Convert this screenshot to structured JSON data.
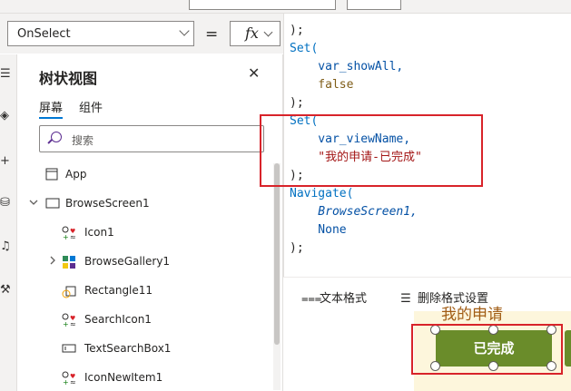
{
  "formula": {
    "property": "OnSelect",
    "equals": "=",
    "fx_label": "fx"
  },
  "tree": {
    "title": "树状视图",
    "close": "✕",
    "tabs": [
      "屏幕",
      "组件"
    ],
    "search_placeholder": "搜索",
    "items": [
      {
        "label": "App"
      },
      {
        "label": "BrowseScreen1"
      },
      {
        "label": "Icon1"
      },
      {
        "label": "BrowseGallery1"
      },
      {
        "label": "Rectangle11"
      },
      {
        "label": "SearchIcon1"
      },
      {
        "label": "TextSearchBox1"
      },
      {
        "label": "IconNewItem1"
      }
    ]
  },
  "code_lines": [
    ");",
    "Set(",
    "    var_showAll,",
    "    false",
    ");",
    "Set(",
    "    var_viewName,",
    "    \"我的申请-已完成\"",
    ");",
    "Navigate(",
    "    BrowseScreen1,",
    "    None",
    ");"
  ],
  "editor_footer": {
    "format_text": "文本格式",
    "remove_format": "删除格式设置"
  },
  "canvas": {
    "card_title": "我的申请",
    "button_label": "已完成"
  },
  "colors": {
    "accent": "#0078d4",
    "highlight": "#d8232a",
    "button_green": "#6a8c2a"
  }
}
